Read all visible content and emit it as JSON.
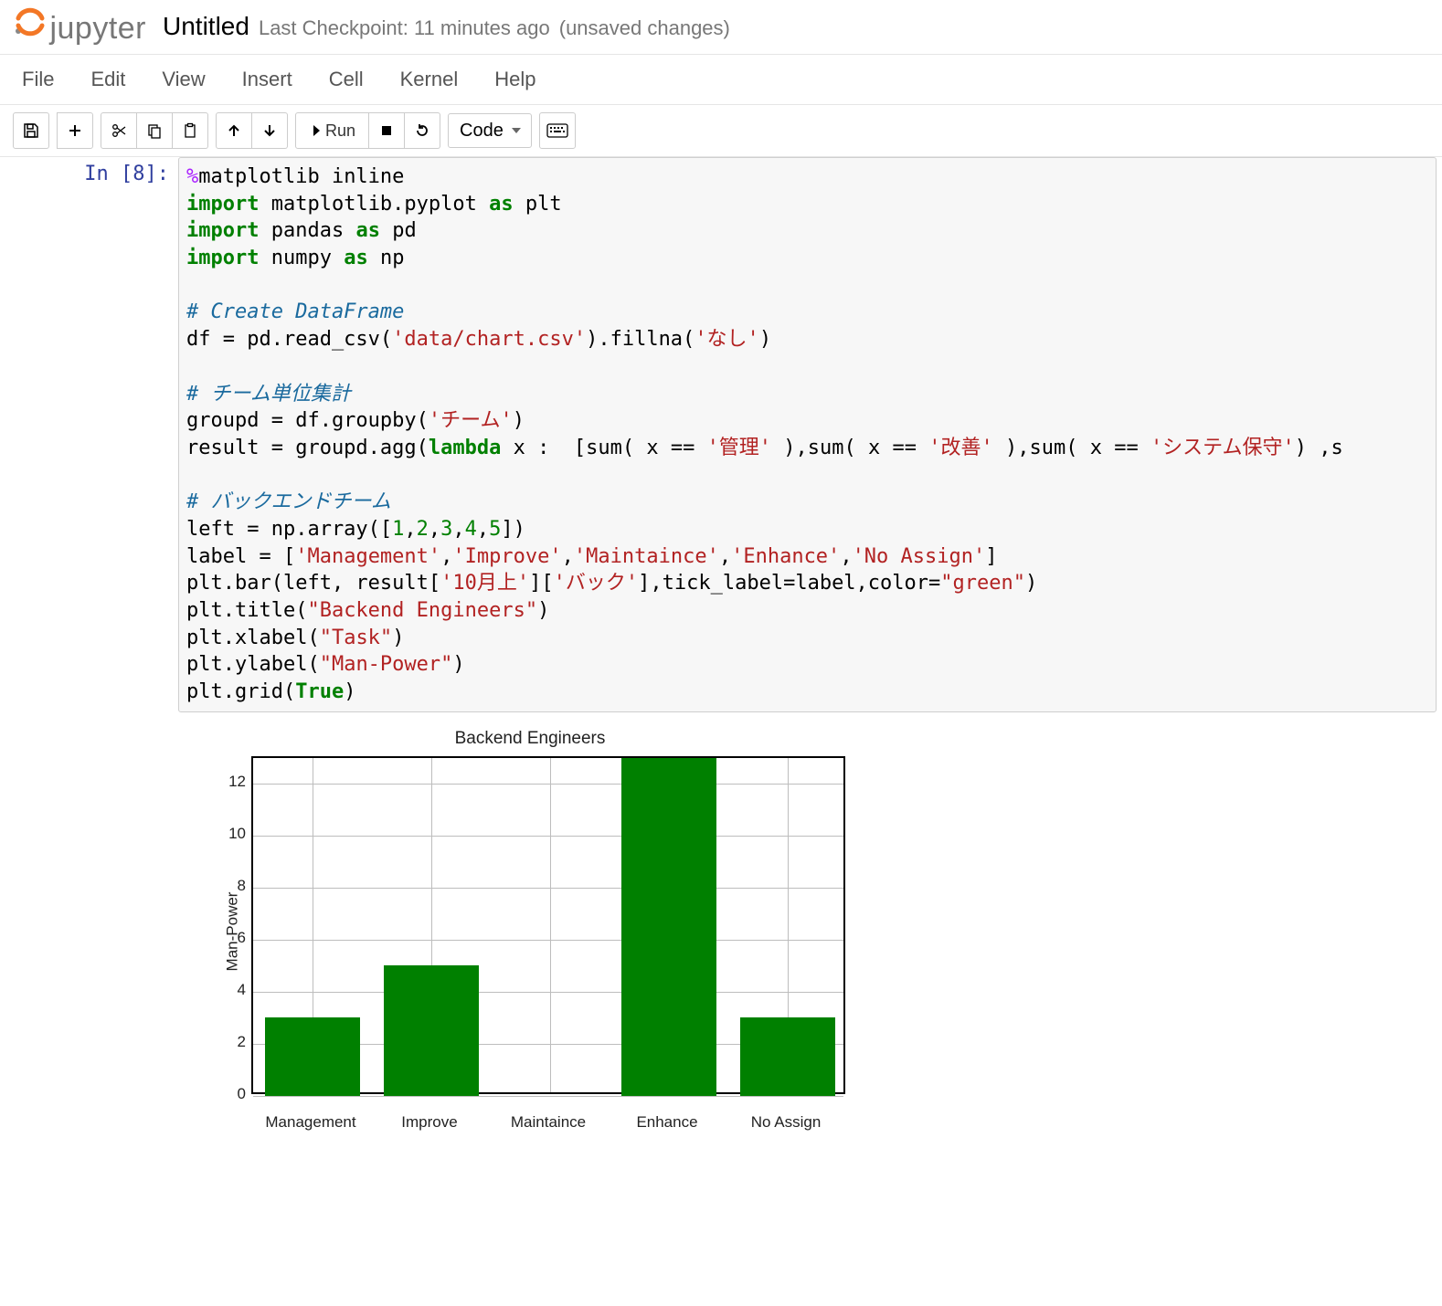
{
  "header": {
    "logo_text": "jupyter",
    "notebook_name": "Untitled",
    "checkpoint": "Last Checkpoint: 11 minutes ago",
    "unsaved": "(unsaved changes)"
  },
  "menubar": [
    "File",
    "Edit",
    "View",
    "Insert",
    "Cell",
    "Kernel",
    "Help"
  ],
  "toolbar": {
    "run_label": "Run",
    "cell_type": "Code"
  },
  "cell": {
    "prompt": "In [8]:",
    "code_plain": "%matplotlib inline\nimport matplotlib.pyplot as plt\nimport pandas as pd\nimport numpy as np\n\n# Create DataFrame\ndf = pd.read_csv('data/chart.csv').fillna('なし')\n\n# チーム単位集計\ngroupd = df.groupby('チーム')\nresult = groupd.agg(lambda x :  [sum( x == '管理' ),sum( x == '改善' ),sum( x == 'システム保守') ,s\n\n# バックエンドチーム\nleft = np.array([1,2,3,4,5])\nlabel = ['Management','Improve','Maintaince','Enhance','No Assign']\nplt.bar(left, result['10月上']['バック'],tick_label=label,color=\"green\")\nplt.title(\"Backend Engineers\")\nplt.xlabel(\"Task\")\nplt.ylabel(\"Man-Power\")\nplt.grid(True)"
  },
  "chart_data": {
    "type": "bar",
    "title": "Backend Engineers",
    "xlabel": "Task",
    "ylabel": "Man-Power",
    "categories": [
      "Management",
      "Improve",
      "Maintaince",
      "Enhance",
      "No Assign"
    ],
    "values": [
      3,
      5,
      0,
      13,
      3
    ],
    "yticks": [
      0,
      2,
      4,
      6,
      8,
      10,
      12
    ],
    "ylim": [
      0,
      13
    ],
    "bar_color": "#008000",
    "grid": true
  }
}
